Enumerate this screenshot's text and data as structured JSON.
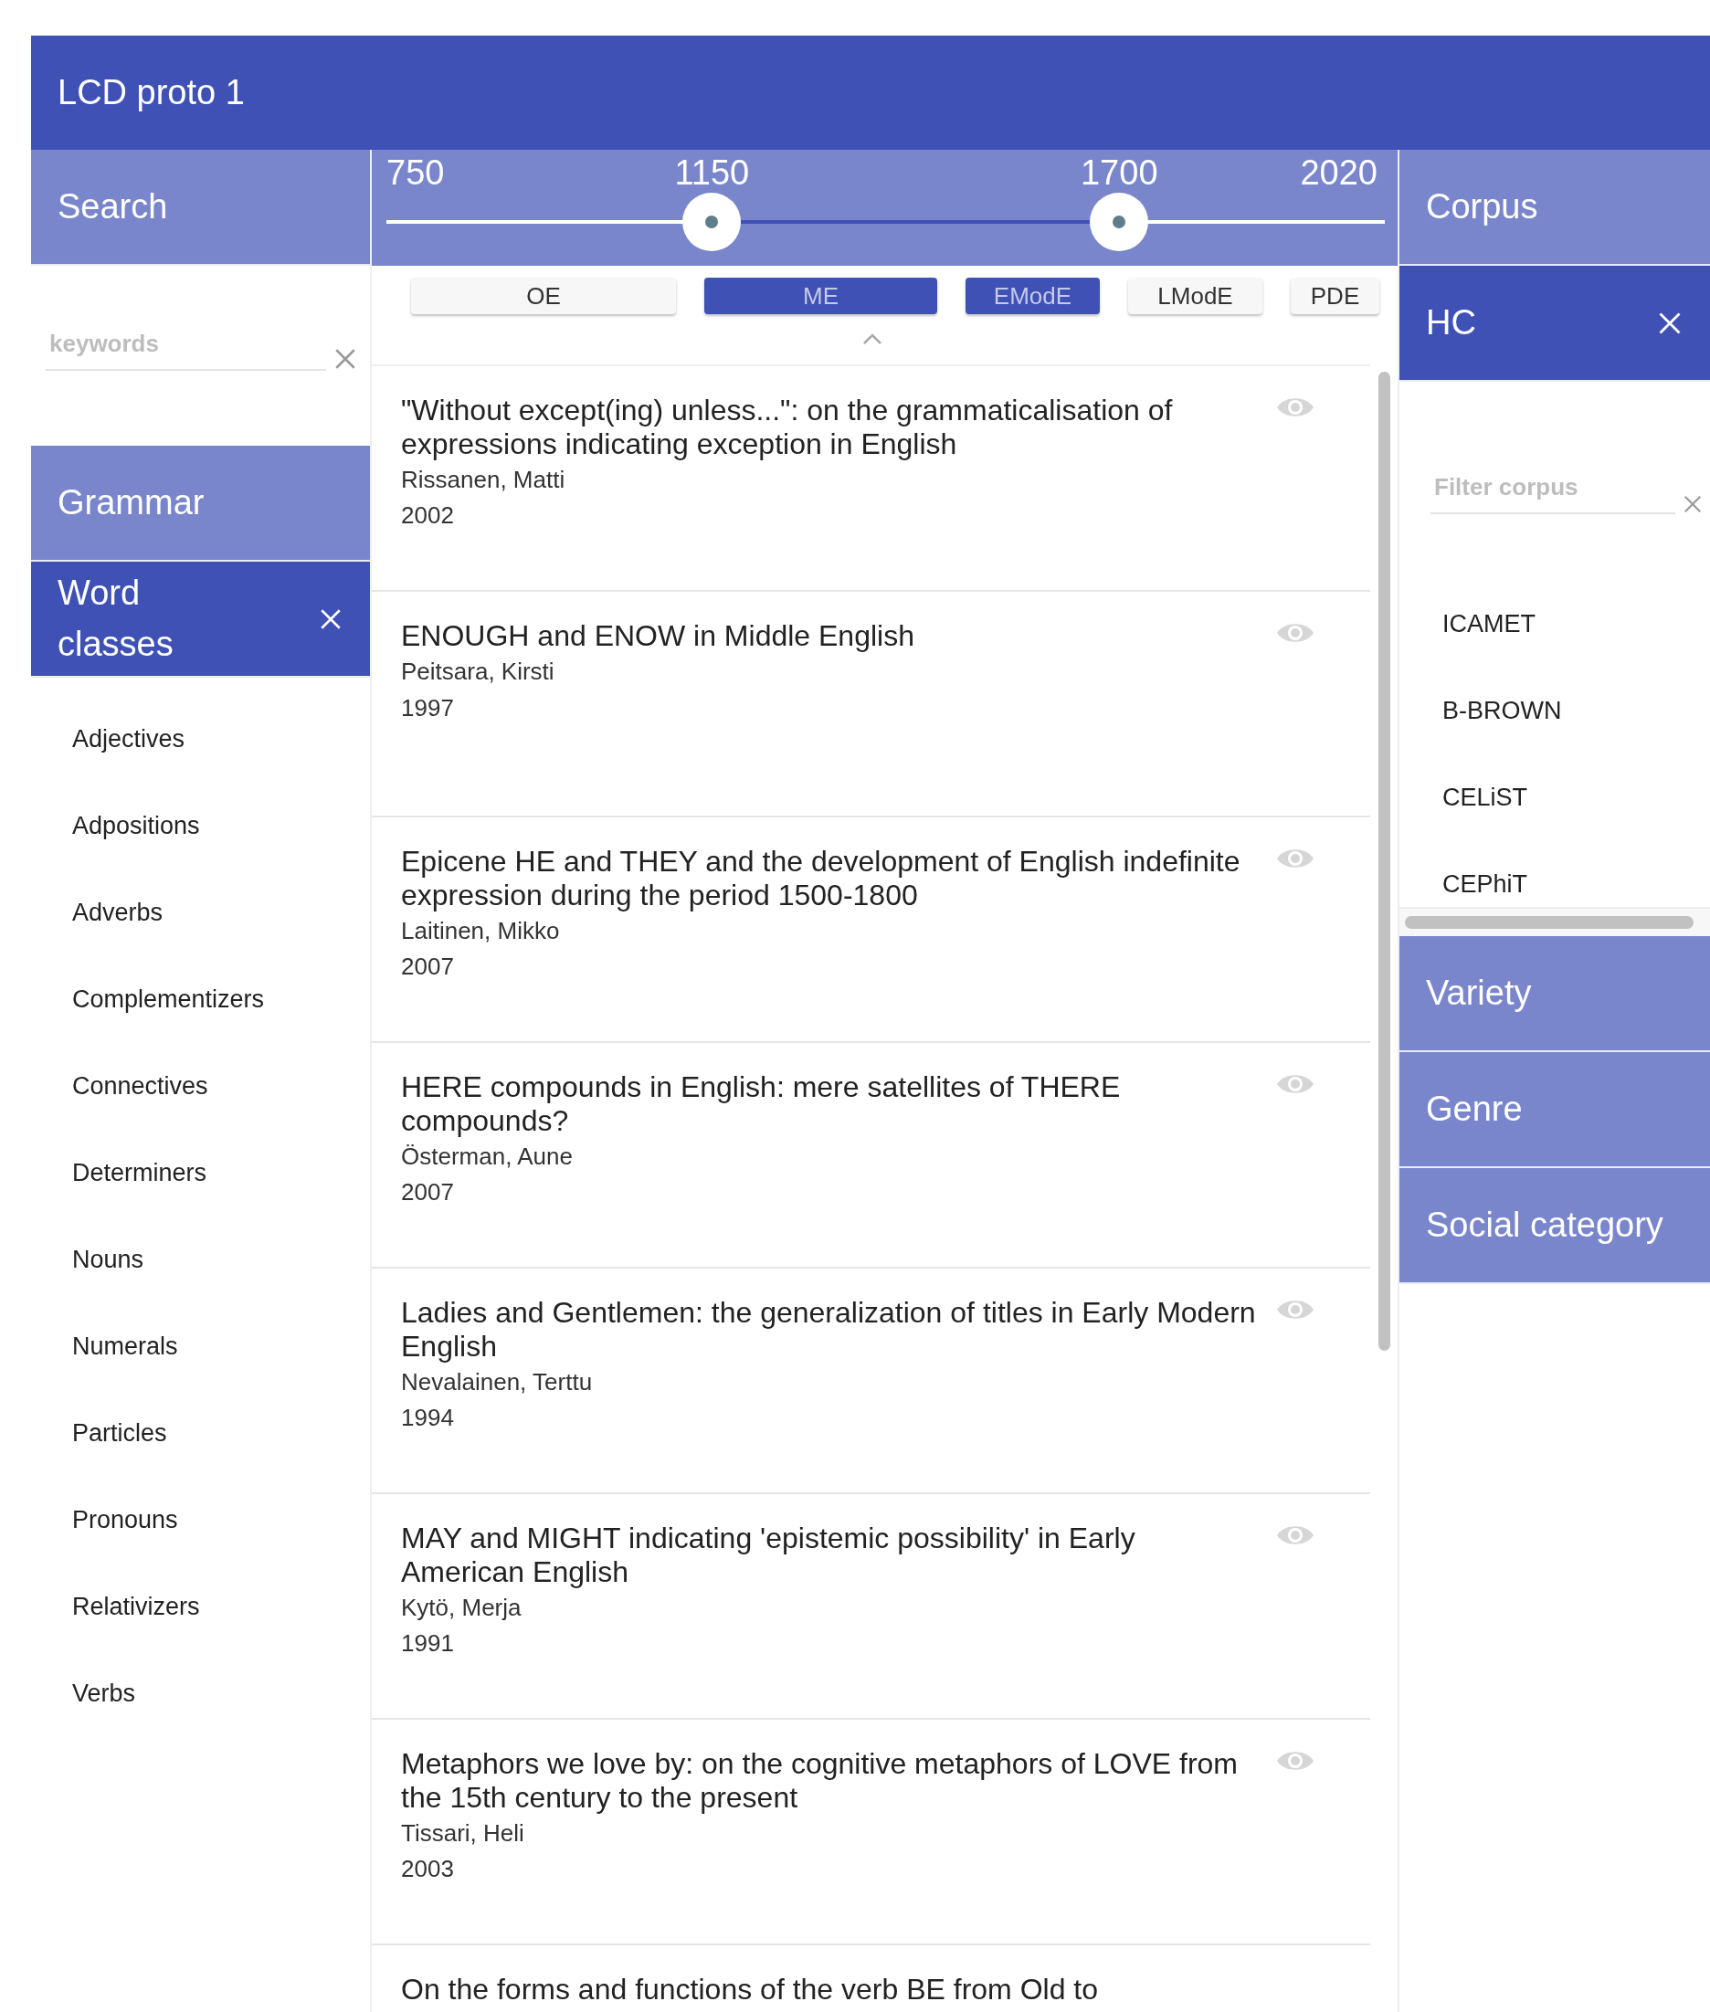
{
  "app_title": "LCD proto 1",
  "search": {
    "title": "Search",
    "placeholder": "keywords"
  },
  "timeline": {
    "min_label": "750",
    "max_label": "2020",
    "thumbs": [
      {
        "label": "1150",
        "level": 0.326
      },
      {
        "label": "1700",
        "level": 0.734
      }
    ]
  },
  "periods": [
    {
      "label": "OE",
      "selected": false
    },
    {
      "label": "ME",
      "selected": true
    },
    {
      "label": "EModE",
      "selected": true
    },
    {
      "label": "LModE",
      "selected": false
    },
    {
      "label": "PDE",
      "selected": false
    }
  ],
  "grammar": {
    "title": "Grammar",
    "filter": "Word classes",
    "items": [
      "Adjectives",
      "Adpositions",
      "Adverbs",
      "Complementizers",
      "Connectives",
      "Determiners",
      "Nouns",
      "Numerals",
      "Particles",
      "Pronouns",
      "Relativizers",
      "Verbs"
    ]
  },
  "results": [
    {
      "title": "\"Without except(ing) unless...\": on the grammaticalisation of expressions indicating exception in English",
      "author": "Rissanen, Matti",
      "year": "2002"
    },
    {
      "title": "ENOUGH and ENOW in Middle English",
      "author": "Peitsara, Kirsti",
      "year": "1997"
    },
    {
      "title": "Epicene HE and THEY and the development of English indefinite expression during the period 1500-1800",
      "author": "Laitinen, Mikko",
      "year": "2007"
    },
    {
      "title": "HERE compounds in English: mere satellites of THERE compounds?",
      "author": "Österman, Aune",
      "year": "2007"
    },
    {
      "title": "Ladies and Gentlemen: the generalization of titles in Early Modern English",
      "author": "Nevalainen, Terttu",
      "year": "1994"
    },
    {
      "title": "MAY and MIGHT indicating 'epistemic possibility' in Early American English",
      "author": "Kytö, Merja",
      "year": "1991"
    },
    {
      "title": "Metaphors we love by: on the cognitive metaphors of LOVE from the 15th century to the present",
      "author": "Tissari, Heli",
      "year": "2003"
    },
    {
      "title": "On the forms and functions of the verb BE from Old to"
    }
  ],
  "corpus": {
    "title": "Corpus",
    "filter": "HC",
    "placeholder": "Filter corpus",
    "items": [
      "ICAMET",
      "B-BROWN",
      "CELiST",
      "CEPhiT"
    ]
  },
  "facets": [
    "Variety",
    "Genre",
    "Social category"
  ]
}
